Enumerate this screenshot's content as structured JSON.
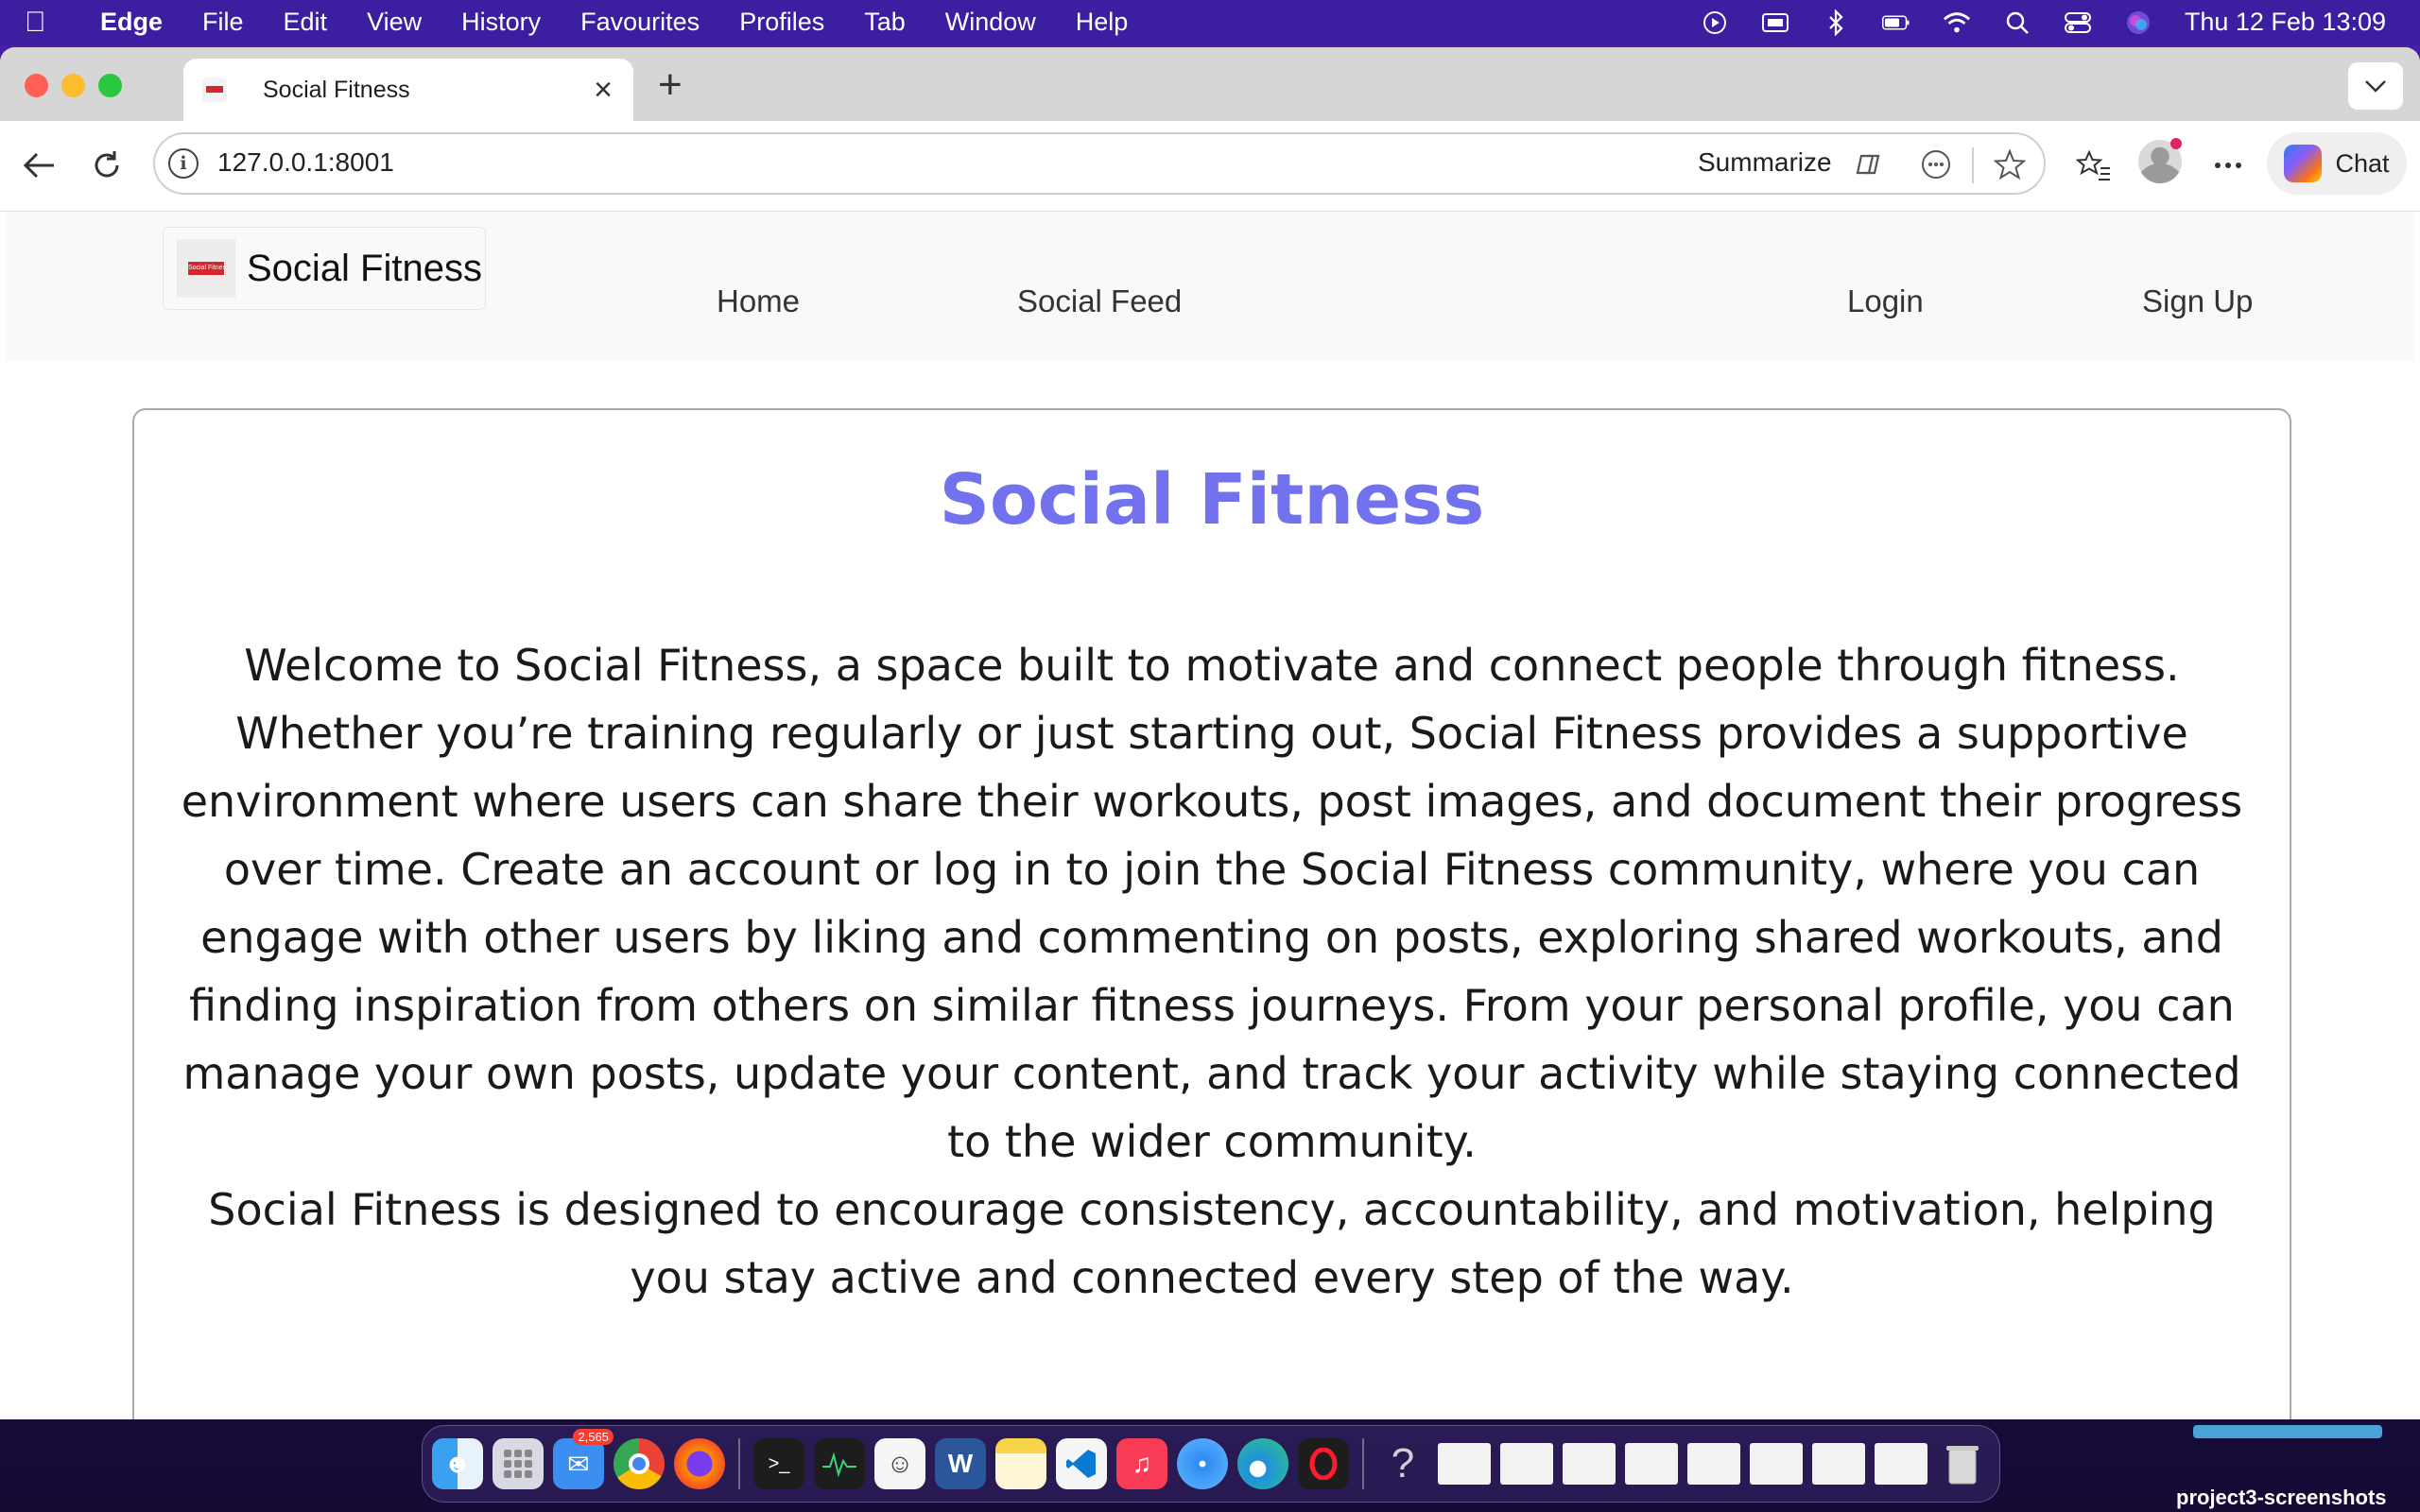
{
  "menubar": {
    "app_name": "Edge",
    "items": [
      "File",
      "Edit",
      "View",
      "History",
      "Favourites",
      "Profiles",
      "Tab",
      "Window",
      "Help"
    ],
    "clock": "Thu 12 Feb  13:09"
  },
  "browser": {
    "tab_title": "Social Fitness",
    "url": "127.0.0.1:8001",
    "summarize_label": "Summarize",
    "chat_label": "Chat"
  },
  "site": {
    "brand_name": "Social Fitness",
    "logo_text": "Social Fitness",
    "nav": {
      "home": "Home",
      "feed": "Social Feed",
      "login": "Login",
      "signup": "Sign Up"
    }
  },
  "hero": {
    "title": "Social Fitness",
    "paragraph_1": "Welcome to Social Fitness, a space built to motivate and connect people through fitness. Whether you’re training regularly or just starting out, Social Fitness provides a supportive environment where users can share their workouts, post images, and document their progress over time. Create an account or log in to join the Social Fitness community, where you can engage with other users by liking and commenting on posts, exploring shared workouts, and finding inspiration from others on similar fitness journeys. From your personal profile, you can manage your own posts, update your content, and track your activity while staying connected to the wider community.",
    "paragraph_2": "Social Fitness is designed to encourage consistency, accountability, and motivation, helping you stay active and connected every step of the way."
  },
  "dock": {
    "mail_badge": "2,565",
    "help_glyph": "?"
  },
  "desktop": {
    "folder_label": "project3-screenshots"
  },
  "colors": {
    "menubar": "#3c1ea0",
    "hero_title": "#7272ee",
    "nav_background": "#f8f9fa"
  }
}
